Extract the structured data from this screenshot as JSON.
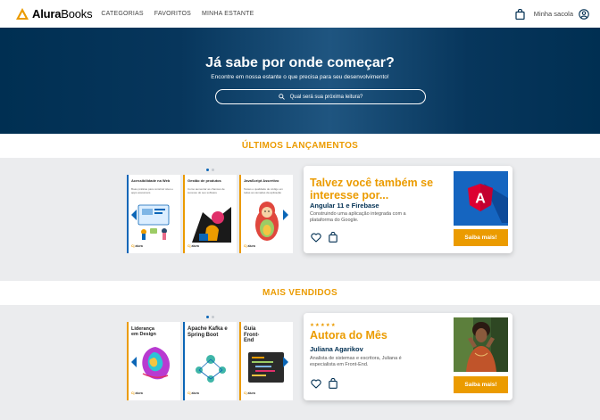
{
  "header": {
    "logo_text_bold": "Alura",
    "logo_text_light": "Books",
    "nav": [
      "CATEGORIAS",
      "FAVORITOS",
      "MINHA ESTANTE"
    ],
    "bag_label": "Minha sacola",
    "icons": [
      "logo-triangle-icon",
      "shopping-bag-icon",
      "user-icon"
    ]
  },
  "hero": {
    "title": "Já sabe por onde começar?",
    "subtitle": "Encontre em nossa estante o que precisa para seu desenvolvimento!",
    "search_placeholder": "Qual será sua próxima leitura?"
  },
  "colors": {
    "brand_orange": "#eb9b00",
    "navy": "#002f52",
    "accent_blue": "#0b66b7",
    "angular_red": "#dd0031"
  },
  "sections": [
    {
      "title": "ÚLTIMOS LANÇAMENTOS",
      "books": [
        {
          "title": "Acessibilidade na Web",
          "desc": "Boas práticas para construir sites e apps acessíveis",
          "spine": "#0b66b7",
          "art": "web"
        },
        {
          "title": "Gestão de produtos",
          "desc": "Como aumentar as chances de sucesso do seu software",
          "spine": "#eb9b00",
          "art": "gestao"
        },
        {
          "title": "JavaScript Assertivo",
          "desc": "Testes e qualidade de código em todas as camadas da aplicação",
          "spine": "#eb9b00",
          "art": "js"
        }
      ],
      "publisher": {
        "brand": "Casa do Código",
        "house": "alura"
      },
      "card": {
        "title": "Talvez você também se interesse por...",
        "book_name": "Angular 11 e Firebase",
        "description": "Construindo uma aplicação integrada com a plataforma do Google.",
        "cta": "Saiba mais!",
        "cover_letter": "A"
      }
    },
    {
      "title": "MAIS VENDIDOS",
      "books": [
        {
          "title": "Liderança em Design",
          "desc": "",
          "spine": "#eb9b00",
          "art": "lideranca"
        },
        {
          "title": "Apache Kafka e Spring Boot",
          "desc": "",
          "spine": "#0b66b7",
          "art": "kafka"
        },
        {
          "title": "Guia Front-End",
          "desc": "",
          "spine": "#eb9b00",
          "art": "frontend"
        }
      ],
      "publisher": {
        "brand": "Casa do Código",
        "house": "alura"
      },
      "card": {
        "stars": "★★★★★",
        "title": "Autora do Mês",
        "author_name": "Juliana Agarikov",
        "description": "Analista de sistemas e escritora, Juliana é especialista em Front-End.",
        "cta": "Saiba mais!"
      }
    }
  ]
}
